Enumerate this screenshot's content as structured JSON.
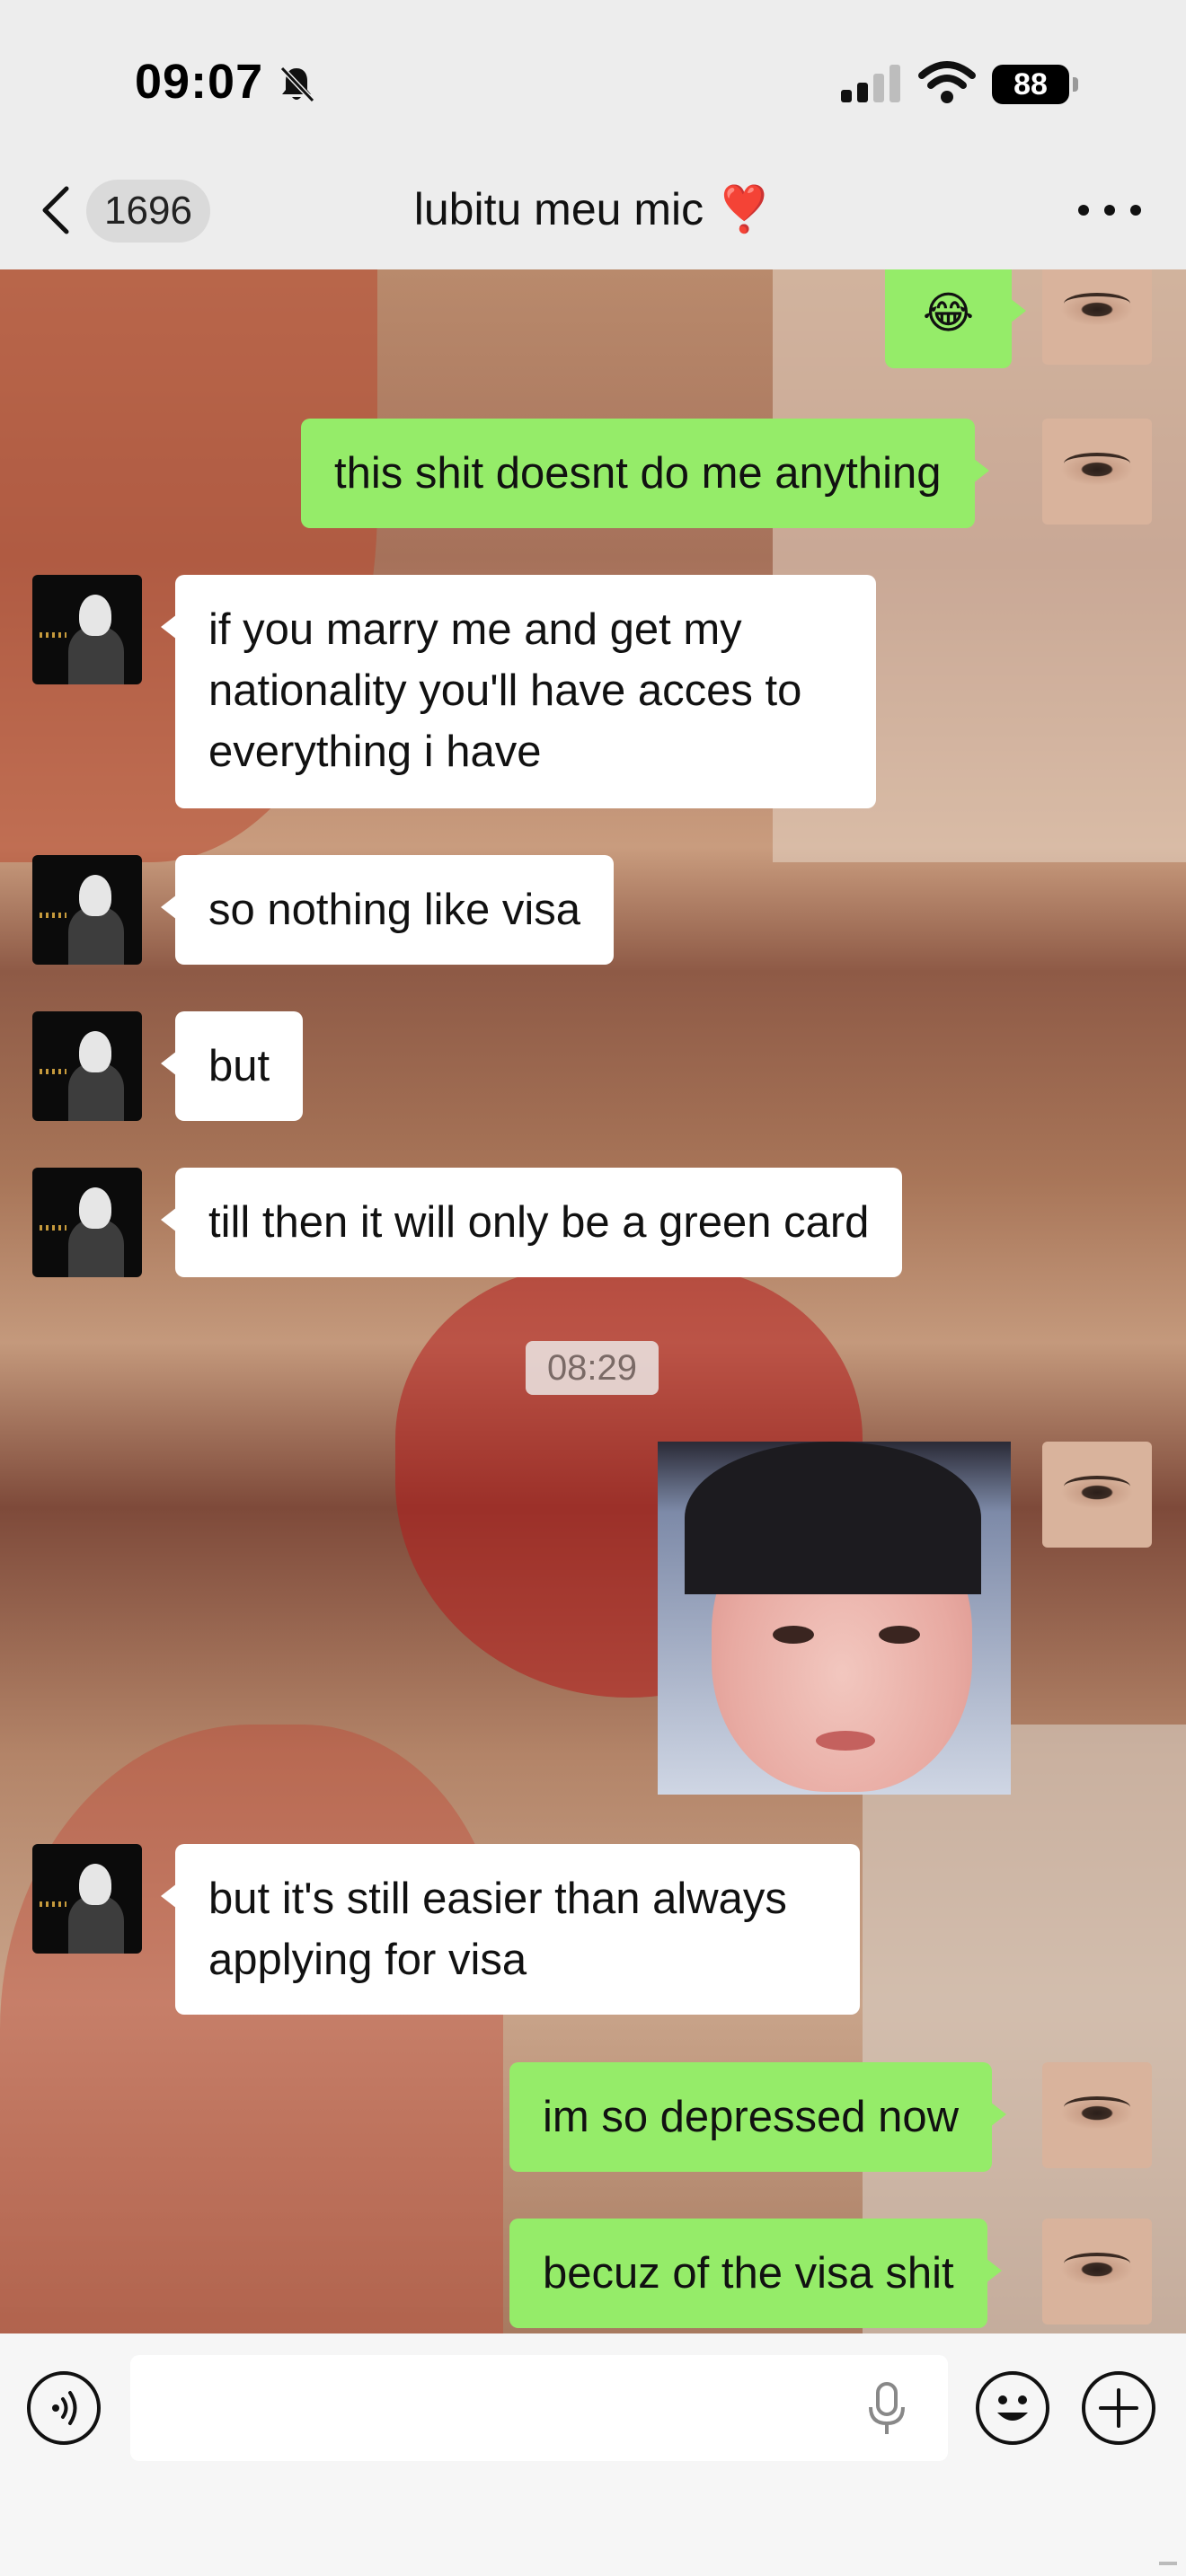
{
  "status_bar": {
    "time": "09:07",
    "battery": "88",
    "icons": [
      "bell-slash-icon",
      "cellular-signal-icon",
      "wifi-icon",
      "battery-icon"
    ]
  },
  "header": {
    "back_count": "1696",
    "title": "lubitu meu mic ❣️",
    "more_icon": "more-dots-icon"
  },
  "messages": [
    {
      "side": "out",
      "text": "😂"
    },
    {
      "side": "out",
      "text": "this shit doesnt do me anything"
    },
    {
      "side": "in",
      "text": "if you marry me and get my\nnationality you'll have acces to\neverything i have"
    },
    {
      "side": "in",
      "text": "so nothing like visa"
    },
    {
      "side": "in",
      "text": "but"
    },
    {
      "side": "in",
      "text": "till then it will only be a green card"
    },
    {
      "side": "time",
      "text": "08:29"
    },
    {
      "side": "out",
      "type": "image",
      "text": ""
    },
    {
      "side": "in",
      "text": "but it's still easier than always\napplying for visa"
    },
    {
      "side": "out",
      "text": "im so depressed now"
    },
    {
      "side": "out",
      "text": "becuz of the visa shit"
    }
  ],
  "input_bar": {
    "voice_icon": "voice-input-icon",
    "input_value": "",
    "mic_icon": "microphone-icon",
    "emoji_icon": "emoji-icon",
    "plus_icon": "plus-icon"
  },
  "colors": {
    "outgoing_bubble": "#95ec69",
    "incoming_bubble": "#ffffff",
    "bar_background": "#ededed"
  }
}
